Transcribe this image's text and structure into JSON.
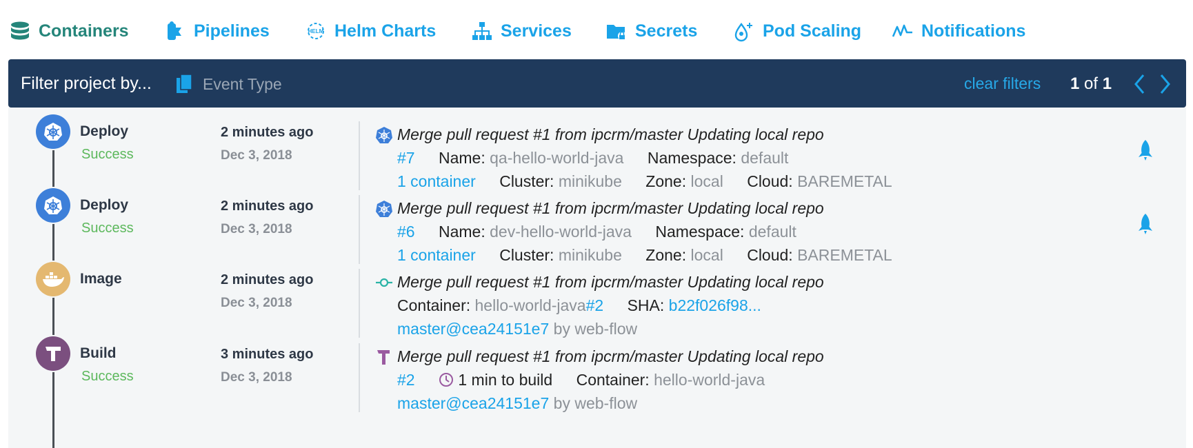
{
  "nav": {
    "items": [
      {
        "label": "Containers",
        "icon": "database-icon",
        "active": true
      },
      {
        "label": "Pipelines",
        "icon": "pipeline-icon"
      },
      {
        "label": "Helm Charts",
        "icon": "helm-icon"
      },
      {
        "label": "Services",
        "icon": "sitemap-icon"
      },
      {
        "label": "Secrets",
        "icon": "folder-lock-icon"
      },
      {
        "label": "Pod Scaling",
        "icon": "pod-scaling-icon"
      },
      {
        "label": "Notifications",
        "icon": "pulse-icon"
      }
    ],
    "helm_badge": "HELM"
  },
  "filter": {
    "title": "Filter project by...",
    "event_type": "Event Type",
    "clear": "clear filters",
    "page_current": "1",
    "page_of": "of",
    "page_total": "1"
  },
  "events": [
    {
      "type": "Deploy",
      "status": "Success",
      "time": "2 minutes ago",
      "date": "Dec 3, 2018",
      "message": "Merge pull request #1 from ipcrm/master Updating local repo",
      "number": "#7",
      "name_label": "Name:",
      "name": "qa-hello-world-java",
      "namespace_label": "Namespace:",
      "namespace": "default",
      "containers": "1 container",
      "cluster_label": "Cluster:",
      "cluster": "minikube",
      "zone_label": "Zone:",
      "zone": "local",
      "cloud_label": "Cloud:",
      "cloud": "BAREMETAL"
    },
    {
      "type": "Deploy",
      "status": "Success",
      "time": "2 minutes ago",
      "date": "Dec 3, 2018",
      "message": "Merge pull request #1 from ipcrm/master Updating local repo",
      "number": "#6",
      "name_label": "Name:",
      "name": "dev-hello-world-java",
      "namespace_label": "Namespace:",
      "namespace": "default",
      "containers": "1 container",
      "cluster_label": "Cluster:",
      "cluster": "minikube",
      "zone_label": "Zone:",
      "zone": "local",
      "cloud_label": "Cloud:",
      "cloud": "BAREMETAL"
    },
    {
      "type": "Image",
      "time": "2 minutes ago",
      "date": "Dec 3, 2018",
      "message": "Merge pull request #1 from ipcrm/master Updating local repo",
      "container_label": "Container:",
      "container": "hello-world-java",
      "container_tag": "#2",
      "sha_label": "SHA:",
      "sha": "b22f026f98...",
      "commit": "master@cea24151e7",
      "by": "by web-flow"
    },
    {
      "type": "Build",
      "status": "Success",
      "time": "3 minutes ago",
      "date": "Dec 3, 2018",
      "message": "Merge pull request #1 from ipcrm/master Updating local repo",
      "number": "#2",
      "duration": "1 min to build",
      "container_label": "Container:",
      "container": "hello-world-java",
      "commit": "master@cea24151e7",
      "by": "by web-flow"
    }
  ],
  "colors": {
    "accent": "#1aa3e8",
    "active_nav": "#25857a",
    "filter_bar": "#1f3a5c",
    "success": "#5cb85c",
    "deploy_avatar": "#3d7fd9",
    "image_avatar": "#e4b870",
    "build_avatar": "#7b4f7f",
    "list_bg": "#f4f6f7"
  }
}
